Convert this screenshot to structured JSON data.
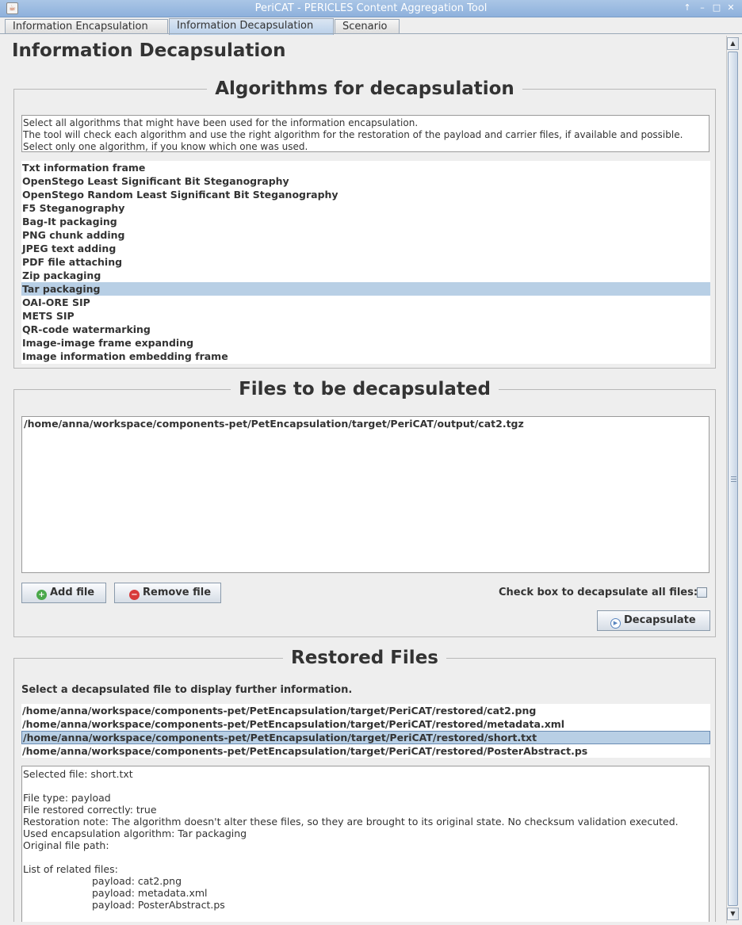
{
  "window": {
    "title": "PeriCAT - PERICLES Content Aggregation Tool",
    "app_icon": "java-cup-icon",
    "controls": {
      "up": "↑",
      "minimize": "–",
      "maximize": "□",
      "close": "✕"
    }
  },
  "tabs": [
    {
      "label": "Information Encapsulation",
      "selected": false
    },
    {
      "label": "Information Decapsulation",
      "selected": true
    },
    {
      "label": "Scenario",
      "selected": false
    }
  ],
  "page": {
    "title": "Information Decapsulation"
  },
  "algorithms": {
    "title": "Algorithms for decapsulation",
    "instructions": [
      "Select all algorithms that might have been used for the information encapsulation.",
      "The tool will check each algorithm and use the right algorithm for the restoration of the payload and carrier files, if available and possible.",
      "Select only one algorithm, if you know which one was used."
    ],
    "items": [
      "Txt information frame",
      "OpenStego Least Significant Bit Steganography",
      "OpenStego Random Least Significant Bit Steganography",
      "F5 Steganography",
      "Bag-It packaging",
      "PNG chunk adding",
      "JPEG text adding",
      "PDF file attaching",
      "Zip packaging",
      "Tar packaging",
      "OAI-ORE SIP",
      "METS SIP",
      "QR-code watermarking",
      "Image-image frame expanding",
      "Image information embedding frame"
    ],
    "selected_index": 9
  },
  "files": {
    "title": "Files to be decapsulated",
    "items": [
      "/home/anna/workspace/components-pet/PetEncapsulation/target/PeriCAT/output/cat2.tgz"
    ],
    "add_label": "Add file",
    "remove_label": "Remove file",
    "check_all_label": "Check box to decapsulate all files:",
    "check_all_checked": false,
    "decapsulate_label": "Decapsulate"
  },
  "restored": {
    "title": "Restored Files",
    "instruction": "Select a decapsulated file to display further information.",
    "items": [
      "/home/anna/workspace/components-pet/PetEncapsulation/target/PeriCAT/restored/cat2.png",
      "/home/anna/workspace/components-pet/PetEncapsulation/target/PeriCAT/restored/metadata.xml",
      "/home/anna/workspace/components-pet/PetEncapsulation/target/PeriCAT/restored/short.txt",
      "/home/anna/workspace/components-pet/PetEncapsulation/target/PeriCAT/restored/PosterAbstract.ps"
    ],
    "selected_index": 2,
    "details": {
      "selected_file": "Selected file: short.txt",
      "file_type": "File type: payload",
      "restored_correctly": "File restored correctly: true",
      "restoration_note": "Restoration note: The algorithm doesn't alter these files, so they are brought to its original state. No checksum validation executed.",
      "algorithm": "Used encapsulation algorithm: Tar packaging",
      "original_path": "Original file path:",
      "related_header": "List of related files:",
      "related": [
        "payload: cat2.png",
        "payload: metadata.xml",
        "payload: PosterAbstract.ps"
      ]
    }
  },
  "colors": {
    "titlebar": "#8eb1dc",
    "selection": "#b8cfe5",
    "add_icon": "#4aa84a",
    "remove_icon": "#d83a3a",
    "decapsulate_icon": "#5a86c0"
  }
}
